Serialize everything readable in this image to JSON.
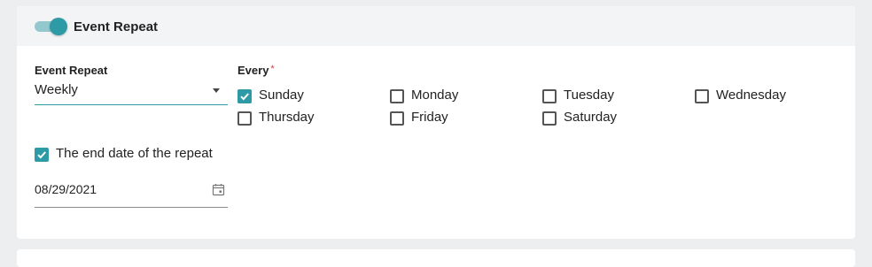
{
  "header": {
    "title": "Event Repeat",
    "toggle_on": true
  },
  "repeat": {
    "label": "Event Repeat",
    "value": "Weekly"
  },
  "every": {
    "label": "Every",
    "required_mark": "*",
    "days": [
      {
        "label": "Sunday",
        "checked": true
      },
      {
        "label": "Monday",
        "checked": false
      },
      {
        "label": "Tuesday",
        "checked": false
      },
      {
        "label": "Wednesday",
        "checked": false
      },
      {
        "label": "Thursday",
        "checked": false
      },
      {
        "label": "Friday",
        "checked": false
      },
      {
        "label": "Saturday",
        "checked": false
      }
    ]
  },
  "end_date": {
    "checkbox_label": "The end date of the repeat",
    "checked": true,
    "value": "08/29/2021"
  },
  "colors": {
    "accent": "#2d9aa6",
    "accent_light": "#93c9ce",
    "required": "#d23b3b",
    "page_bg": "#eceeef"
  },
  "icons": {
    "calendar": "calendar-icon",
    "dropdown": "chevron-down-icon",
    "check": "check-icon"
  }
}
